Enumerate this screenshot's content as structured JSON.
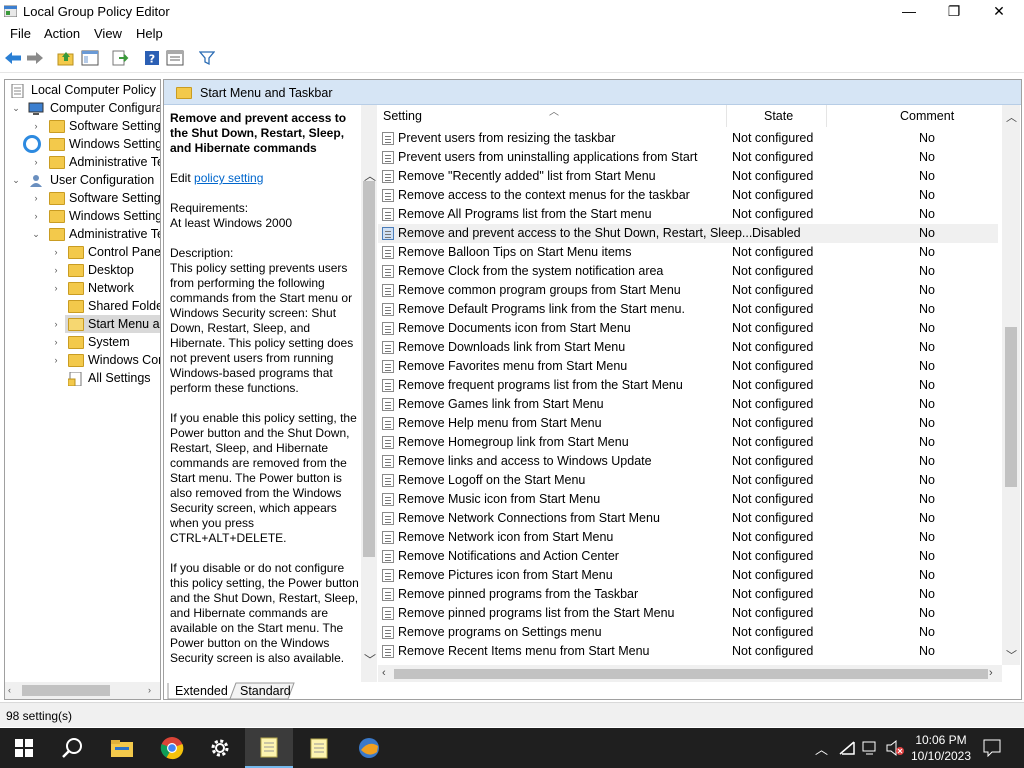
{
  "window": {
    "title": "Local Group Policy Editor",
    "minimize_glyph": "—",
    "maximize_glyph": "❐",
    "close_glyph": "✕"
  },
  "menu": {
    "file": "File",
    "action": "Action",
    "view": "View",
    "help": "Help"
  },
  "toolbar": {
    "icons": [
      "back-arrow-icon",
      "forward-arrow-icon",
      "up-folder-icon",
      "show-hide-tree-icon",
      "export-list-icon",
      "help-icon",
      "properties-icon",
      "filter-icon"
    ]
  },
  "tree": {
    "root": "Local Computer Policy",
    "computer_configuration": "Computer Configura",
    "cc_software_settings": "Software Settings",
    "cc_windows_settings": "Windows Setting",
    "cc_administrative_templates": "Administrative Te",
    "user_configuration": "User Configuration",
    "uc_software_settings": "Software Settings",
    "uc_windows_settings": "Windows Setting",
    "uc_administrative_templates": "Administrative Te",
    "control_panel": "Control Panel",
    "desktop": "Desktop",
    "network": "Network",
    "shared_folders": "Shared Folder",
    "start_menu": "Start Menu ar",
    "system": "System",
    "windows_components": "Windows Cor",
    "all_settings": "All Settings"
  },
  "main": {
    "header": "Start Menu and Taskbar",
    "description": {
      "heading": "Remove and prevent access to the Shut Down, Restart, Sleep, and Hibernate commands",
      "edit_prefix": "Edit ",
      "edit_link": "policy setting",
      "requirements_label": "Requirements:",
      "requirements_value": "At least Windows 2000",
      "description_label": "Description:",
      "description_text": "This policy setting prevents users from performing the following commands from the Start menu or Windows Security screen: Shut Down, Restart, Sleep, and Hibernate. This policy setting does not prevent users from running Windows-based programs that perform these functions.",
      "enable_text": "If you enable this policy setting, the Power button and the Shut Down, Restart, Sleep, and Hibernate commands are removed from the Start menu. The Power button is also removed from the Windows Security screen, which appears when you press CTRL+ALT+DELETE.",
      "disable_text": "If you disable or do not configure this policy setting, the Power button and the Shut Down, Restart, Sleep, and Hibernate commands are available on the Start menu. The Power button on the Windows Security screen is also available."
    },
    "columns": {
      "setting": "Setting",
      "state": "State",
      "comment": "Comment"
    },
    "rows": [
      {
        "setting": "Prevent users from resizing the taskbar",
        "state": "Not configured",
        "comment": "No"
      },
      {
        "setting": "Prevent users from uninstalling applications from Start",
        "state": "Not configured",
        "comment": "No"
      },
      {
        "setting": "Remove \"Recently added\" list from Start Menu",
        "state": "Not configured",
        "comment": "No"
      },
      {
        "setting": "Remove access to the context menus for the taskbar",
        "state": "Not configured",
        "comment": "No"
      },
      {
        "setting": "Remove All Programs list from the Start menu",
        "state": "Not configured",
        "comment": "No"
      },
      {
        "setting": "Remove and prevent access to the Shut Down, Restart, Sleep...",
        "state": "Disabled",
        "comment": "No"
      },
      {
        "setting": "Remove Balloon Tips on Start Menu items",
        "state": "Not configured",
        "comment": "No"
      },
      {
        "setting": "Remove Clock from the system notification area",
        "state": "Not configured",
        "comment": "No"
      },
      {
        "setting": "Remove common program groups from Start Menu",
        "state": "Not configured",
        "comment": "No"
      },
      {
        "setting": "Remove Default Programs link from the Start menu.",
        "state": "Not configured",
        "comment": "No"
      },
      {
        "setting": "Remove Documents icon from Start Menu",
        "state": "Not configured",
        "comment": "No"
      },
      {
        "setting": "Remove Downloads link from Start Menu",
        "state": "Not configured",
        "comment": "No"
      },
      {
        "setting": "Remove Favorites menu from Start Menu",
        "state": "Not configured",
        "comment": "No"
      },
      {
        "setting": "Remove frequent programs list from the Start Menu",
        "state": "Not configured",
        "comment": "No"
      },
      {
        "setting": "Remove Games link from Start Menu",
        "state": "Not configured",
        "comment": "No"
      },
      {
        "setting": "Remove Help menu from Start Menu",
        "state": "Not configured",
        "comment": "No"
      },
      {
        "setting": "Remove Homegroup link from Start Menu",
        "state": "Not configured",
        "comment": "No"
      },
      {
        "setting": "Remove links and access to Windows Update",
        "state": "Not configured",
        "comment": "No"
      },
      {
        "setting": "Remove Logoff on the Start Menu",
        "state": "Not configured",
        "comment": "No"
      },
      {
        "setting": "Remove Music icon from Start Menu",
        "state": "Not configured",
        "comment": "No"
      },
      {
        "setting": "Remove Network Connections from Start Menu",
        "state": "Not configured",
        "comment": "No"
      },
      {
        "setting": "Remove Network icon from Start Menu",
        "state": "Not configured",
        "comment": "No"
      },
      {
        "setting": "Remove Notifications and Action Center",
        "state": "Not configured",
        "comment": "No"
      },
      {
        "setting": "Remove Pictures icon from Start Menu",
        "state": "Not configured",
        "comment": "No"
      },
      {
        "setting": "Remove pinned programs from the Taskbar",
        "state": "Not configured",
        "comment": "No"
      },
      {
        "setting": "Remove pinned programs list from the Start Menu",
        "state": "Not configured",
        "comment": "No"
      },
      {
        "setting": "Remove programs on Settings menu",
        "state": "Not configured",
        "comment": "No"
      },
      {
        "setting": "Remove Recent Items menu from Start Menu",
        "state": "Not configured",
        "comment": "No"
      }
    ]
  },
  "tabs": {
    "extended": "Extended",
    "standard": "Standard"
  },
  "status": {
    "count": "98 setting(s)"
  },
  "taskbar": {
    "time": "10:06 PM",
    "date": "10/10/2023"
  }
}
